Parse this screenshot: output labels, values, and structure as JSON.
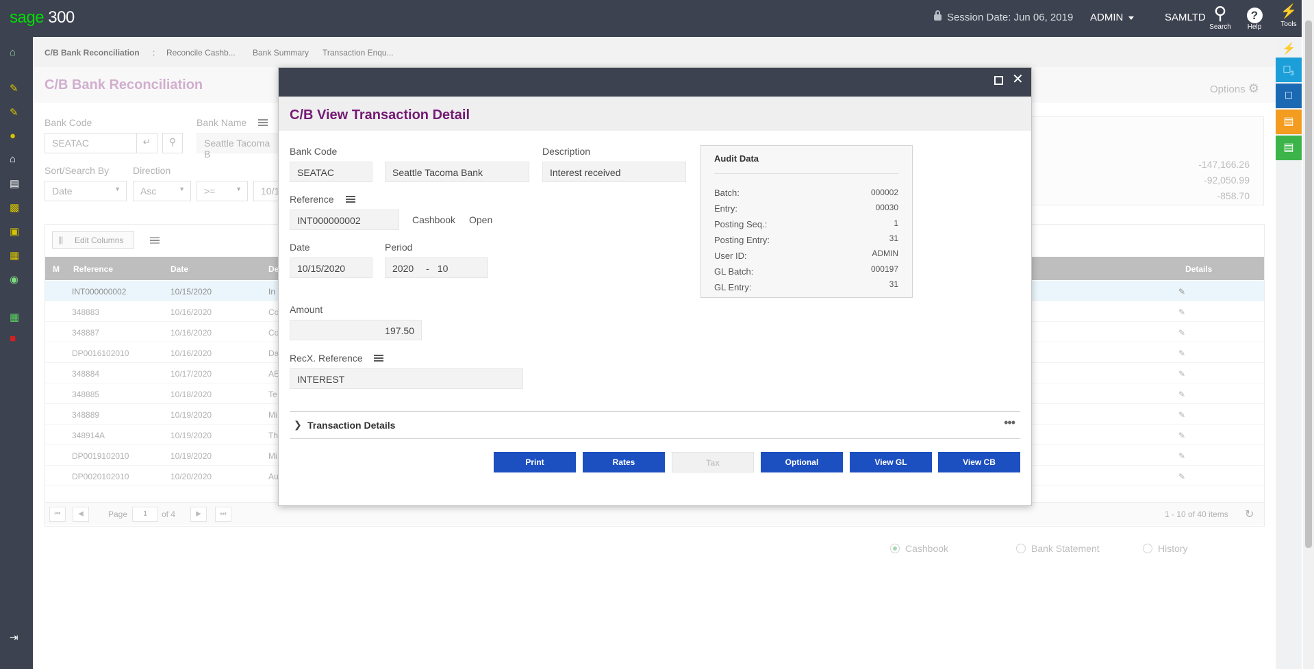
{
  "app": {
    "logo_sage": "sage",
    "logo_num": "300"
  },
  "topbar": {
    "session_label": "Session Date:",
    "session_date": "Jun 06, 2019",
    "user": "ADMIN",
    "company": "SAMLTD",
    "search_label": "Search",
    "help_label": "Help",
    "tools_label": "Tools"
  },
  "rightbar": {
    "badge": "3"
  },
  "breadcrumb": {
    "items": [
      "C/B Bank Reconciliation",
      ":",
      "Reconcile Cashb...",
      "Bank Summary",
      "Transaction Enqu..."
    ]
  },
  "page": {
    "title": "C/B Bank Reconciliation",
    "options_label": "Options"
  },
  "background_form": {
    "bank_code_label": "Bank Code",
    "bank_code": "SEATAC",
    "bank_name_label": "Bank Name",
    "bank_name": "Seattle Tacoma B",
    "sort_label": "Sort/Search By",
    "sort_value": "Date",
    "direction_label": "Direction",
    "direction_value": "Asc",
    "operator_value": ">=",
    "date_value": "10/1",
    "right_values": [
      "-147,166.26",
      "-92,050.99",
      "-858.70"
    ]
  },
  "table": {
    "edit_columns": "Edit Columns",
    "columns": [
      "M",
      "Reference",
      "Date",
      "De",
      "Details"
    ],
    "rows": [
      {
        "ref": "INT000000002",
        "date": "10/15/2020",
        "desc": "In"
      },
      {
        "ref": "348883",
        "date": "10/16/2020",
        "desc": "Co"
      },
      {
        "ref": "348887",
        "date": "10/16/2020",
        "desc": "Co"
      },
      {
        "ref": "DP0016102010",
        "date": "10/16/2020",
        "desc": "Da"
      },
      {
        "ref": "348884",
        "date": "10/17/2020",
        "desc": "AE"
      },
      {
        "ref": "348885",
        "date": "10/18/2020",
        "desc": "Te"
      },
      {
        "ref": "348889",
        "date": "10/19/2020",
        "desc": "Mi"
      },
      {
        "ref": "348914A",
        "date": "10/19/2020",
        "desc": "Th"
      },
      {
        "ref": "DP0019102010",
        "date": "10/19/2020",
        "desc": "Mi"
      },
      {
        "ref": "DP0020102010",
        "date": "10/20/2020",
        "desc": "Au"
      }
    ],
    "pager": {
      "page_label": "Page",
      "page": "1",
      "of": "of 4",
      "summary": "1 - 10 of 40 items"
    }
  },
  "radios": {
    "cashbook": "Cashbook",
    "bank_statement": "Bank Statement",
    "history": "History"
  },
  "modal": {
    "title": "C/B View Transaction Detail",
    "bank_code_label": "Bank Code",
    "bank_code": "SEATAC",
    "bank_name": "Seattle Tacoma Bank",
    "description_label": "Description",
    "description": "Interest received",
    "reference_label": "Reference",
    "reference": "INT000000002",
    "source": "Cashbook",
    "status": "Open",
    "date_label": "Date",
    "date": "10/15/2020",
    "period_label": "Period",
    "period_year": "2020",
    "period_sep": "-",
    "period_num": "10",
    "amount_label": "Amount",
    "amount": "197.50",
    "recx_label": "RecX. Reference",
    "recx": "INTEREST",
    "audit": {
      "title": "Audit Data",
      "items": [
        {
          "k": "Batch:",
          "v": "000002"
        },
        {
          "k": "Entry:",
          "v": "00030"
        },
        {
          "k": "Posting Seq.:",
          "v": "1"
        },
        {
          "k": "Posting Entry:",
          "v": "31"
        },
        {
          "k": "User ID:",
          "v": "ADMIN"
        },
        {
          "k": "GL Batch:",
          "v": "000197"
        },
        {
          "k": "GL Entry:",
          "v": "31"
        }
      ]
    },
    "transaction_details": "Transaction Details",
    "buttons": {
      "print": "Print",
      "rates": "Rates",
      "tax": "Tax",
      "optional": "Optional",
      "view_gl": "View GL",
      "view_cb": "View CB"
    }
  },
  "colors": {
    "topbar": "#3c424f",
    "title_purple": "#741a73",
    "button_blue": "#1c4fc0",
    "logo_green": "#00dc06",
    "selected_row": "#dff1fa"
  }
}
